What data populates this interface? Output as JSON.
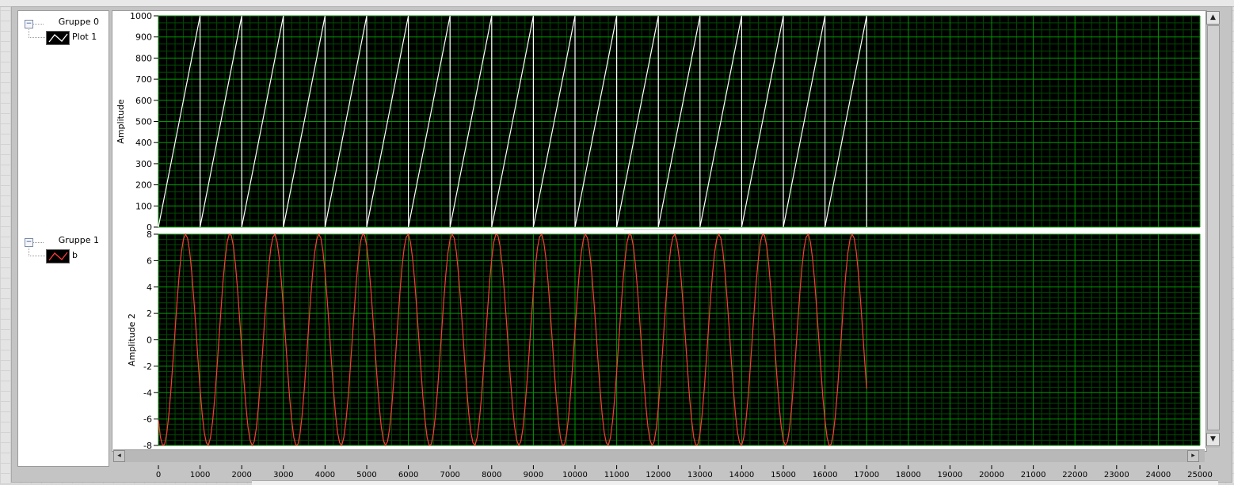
{
  "legend": {
    "groups": [
      {
        "title": "Gruppe 0",
        "plot_name": "Plot 1",
        "plot_color": "#ffffff"
      },
      {
        "title": "Gruppe 1",
        "plot_name": "b",
        "plot_color": "#ff3b3b"
      }
    ]
  },
  "colors": {
    "plot_bg": "#000000",
    "grid_major": "#009a00",
    "grid_minor": "#004a00",
    "sawtooth": "#ffffff",
    "sine": "#ff3b3b"
  },
  "chart_data": [
    {
      "type": "line",
      "ylabel": "Amplitude",
      "ylim": [
        0,
        1000
      ],
      "yticks": [
        "0",
        "100",
        "200",
        "300",
        "400",
        "500",
        "600",
        "700",
        "800",
        "900",
        "1000"
      ],
      "xlim": [
        0,
        25000
      ],
      "grid": true,
      "series": [
        {
          "name": "Plot 1",
          "color": "#ffffff",
          "points": [
            [
              0,
              0
            ],
            [
              1000,
              1000
            ],
            [
              1000,
              0
            ],
            [
              2000,
              1000
            ],
            [
              2000,
              0
            ],
            [
              3000,
              1000
            ],
            [
              3000,
              0
            ],
            [
              4000,
              1000
            ],
            [
              4000,
              0
            ],
            [
              5000,
              1000
            ],
            [
              5000,
              0
            ],
            [
              6000,
              1000
            ],
            [
              6000,
              0
            ],
            [
              7000,
              1000
            ],
            [
              7000,
              0
            ],
            [
              8000,
              1000
            ],
            [
              8000,
              0
            ],
            [
              9000,
              1000
            ],
            [
              9000,
              0
            ],
            [
              10000,
              1000
            ],
            [
              10000,
              0
            ],
            [
              11000,
              1000
            ],
            [
              11000,
              0
            ],
            [
              12000,
              1000
            ],
            [
              12000,
              0
            ],
            [
              13000,
              1000
            ],
            [
              13000,
              0
            ],
            [
              14000,
              1000
            ],
            [
              14000,
              0
            ],
            [
              15000,
              1000
            ],
            [
              15000,
              0
            ],
            [
              16000,
              1000
            ],
            [
              16000,
              0
            ],
            [
              17000,
              1000
            ],
            [
              17000,
              0
            ]
          ]
        }
      ]
    },
    {
      "type": "line",
      "ylabel": "Amplitude 2",
      "ylim": [
        -8,
        8
      ],
      "yticks": [
        "-8",
        "-6",
        "-4",
        "-2",
        "0",
        "2",
        "4",
        "6",
        "8"
      ],
      "xlim": [
        0,
        25000
      ],
      "grid": true,
      "series": [
        {
          "name": "b",
          "color": "#ff3b3b",
          "x_start": 0,
          "x_step": 50,
          "values": [
            -6.1,
            -7.4,
            -8.0,
            -7.9,
            -7.1,
            -5.7,
            -3.8,
            -1.6,
            0.7,
            3.0,
            5.0,
            6.6,
            7.6,
            8.0,
            7.7,
            6.7,
            5.1,
            3.1,
            0.9,
            -1.5,
            -3.7,
            -5.6,
            -7.0,
            -7.8,
            -8.0,
            -7.4,
            -6.2,
            -4.5,
            -2.4,
            -0.1,
            2.2,
            4.4,
            6.1,
            7.4,
            8.0,
            7.9,
            7.1,
            5.7,
            3.8,
            1.6,
            -0.7,
            -3.0,
            -5.0,
            -6.6,
            -7.6,
            -8.0,
            -7.7,
            -6.7,
            -5.1,
            -3.1,
            -0.9,
            1.5,
            3.7,
            5.6,
            7.0,
            7.8,
            8.0,
            7.4,
            6.2,
            4.5,
            2.4,
            0.1,
            -2.2,
            -4.4,
            -6.1,
            -7.4,
            -8.0,
            -7.9,
            -7.1,
            -5.7,
            -3.8,
            -1.6,
            0.7,
            3.0,
            5.0,
            6.6,
            7.6,
            8.0,
            7.7,
            6.7,
            5.1,
            3.1,
            0.9,
            -1.5,
            -3.7,
            -5.6,
            -7.0,
            -7.8,
            -8.0,
            -7.4,
            -6.2,
            -4.5,
            -2.4,
            -0.1,
            2.2,
            4.4,
            6.1,
            7.4,
            8.0,
            7.9,
            7.1,
            5.7,
            3.8,
            1.6,
            -0.7,
            -3.0,
            -5.0,
            -6.6,
            -7.6,
            -8.0,
            -7.7,
            -6.7,
            -5.1,
            -3.1,
            -0.9,
            1.5,
            3.7,
            5.6,
            7.0,
            7.8,
            8.0,
            7.4,
            6.2,
            4.5,
            2.4,
            0.1,
            -2.2,
            -4.4,
            -6.1,
            -7.4,
            -8.0,
            -7.9,
            -7.1,
            -5.7,
            -3.8,
            -1.6,
            0.7,
            3.0,
            5.0,
            6.6,
            7.6,
            8.0,
            7.7,
            6.7,
            5.1,
            3.1,
            0.9,
            -1.5,
            -3.7,
            -5.6,
            -7.0,
            -7.8,
            -8.0,
            -7.4,
            -6.2,
            -4.5,
            -2.4,
            -0.1,
            2.2,
            4.4,
            6.1,
            7.4,
            8.0,
            7.9,
            7.1,
            5.7,
            3.8,
            1.6,
            -0.7,
            -3.0,
            -5.0,
            -6.6,
            -7.6,
            -8.0,
            -7.7,
            -6.7,
            -5.1,
            -3.1,
            -0.9,
            1.5,
            3.7,
            5.6,
            7.0,
            7.8,
            8.0,
            7.4,
            6.2,
            4.5,
            2.4,
            0.1,
            -2.2,
            -4.4,
            -6.1,
            -7.4,
            -8.0,
            -7.9,
            -7.1,
            -5.7,
            -3.8,
            -1.6,
            0.7,
            3.0,
            5.0,
            6.6,
            7.6,
            8.0,
            7.7,
            6.7,
            5.1,
            3.1,
            0.9,
            -1.5,
            -3.7,
            -5.6,
            -7.0,
            -7.8,
            -8.0,
            -7.4,
            -6.2,
            -4.5,
            -2.4,
            -0.1,
            2.2,
            4.4,
            6.1,
            7.4,
            8.0,
            7.9,
            7.1,
            5.7,
            3.8,
            1.6,
            -0.7,
            -3.0,
            -5.0,
            -6.6,
            -7.6,
            -8.0,
            -7.7,
            -6.7,
            -5.1,
            -3.1,
            -0.9,
            1.5,
            3.7,
            5.6,
            7.0,
            7.8,
            8.0,
            7.4,
            6.2,
            4.5,
            2.4,
            0.1,
            -2.2,
            -4.4,
            -6.1,
            -7.4,
            -8.0,
            -7.9,
            -7.1,
            -5.7,
            -3.8,
            -1.6,
            0.7,
            3.0,
            5.0,
            6.6,
            7.6,
            8.0,
            7.7,
            6.7,
            5.1,
            3.1,
            0.9,
            -1.5,
            -3.7,
            -5.6,
            -7.0,
            -7.8,
            -8.0,
            -7.4,
            -6.2,
            -4.5,
            -2.4,
            -0.1,
            2.2,
            4.4,
            6.1,
            7.4,
            8.0,
            7.9,
            7.1,
            5.7,
            3.8,
            1.6,
            -0.7,
            -3.0,
            -5.0,
            -6.6,
            -7.6,
            -8.0,
            -7.7,
            -6.7,
            -5.1,
            -3.1,
            -0.9,
            1.5,
            3.7,
            5.6,
            7.0,
            7.8,
            8.0,
            7.4,
            6.2,
            4.5,
            2.4,
            0.1,
            -2.2,
            -4.4,
            -6.1,
            -7.4,
            -8.0,
            -7.9,
            -7.1,
            -5.7,
            -3.8,
            -1.6,
            0.7,
            3.0,
            5.0,
            6.6,
            7.6,
            8.0,
            7.7,
            6.7,
            5.1,
            3.1,
            0.9,
            -1.5,
            -3.7
          ]
        }
      ]
    }
  ],
  "x_axis": {
    "ticks": [
      "0",
      "1000",
      "2000",
      "3000",
      "4000",
      "5000",
      "6000",
      "7000",
      "8000",
      "9000",
      "10000",
      "11000",
      "12000",
      "13000",
      "14000",
      "15000",
      "16000",
      "17000",
      "18000",
      "19000",
      "20000",
      "21000",
      "22000",
      "23000",
      "24000",
      "25000"
    ]
  }
}
